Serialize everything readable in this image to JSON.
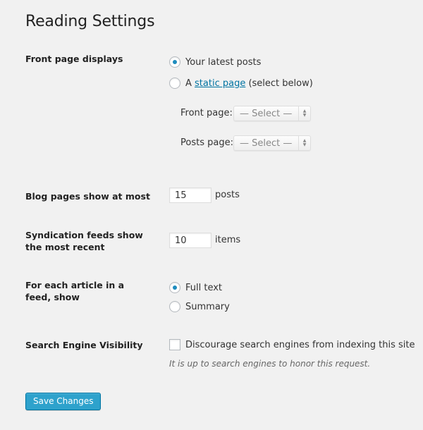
{
  "page": {
    "title": "Reading Settings"
  },
  "front_page_displays": {
    "label": "Front page displays",
    "options": [
      {
        "label": "Your latest posts",
        "checked": true
      },
      {
        "prefix": "A ",
        "link_text": "static page",
        "suffix": " (select below)",
        "checked": false
      }
    ],
    "front_page": {
      "label": "Front page:",
      "selected": "— Select —"
    },
    "posts_page": {
      "label": "Posts page:",
      "selected": "— Select —"
    }
  },
  "blog_pages": {
    "label": "Blog pages show at most",
    "value": "15",
    "unit": "posts"
  },
  "syndication": {
    "label": "Syndication feeds show the most recent",
    "value": "10",
    "unit": "items"
  },
  "feed_article": {
    "label": "For each article in a feed, show",
    "options": [
      {
        "label": "Full text",
        "checked": true
      },
      {
        "label": "Summary",
        "checked": false
      }
    ]
  },
  "search_visibility": {
    "label": "Search Engine Visibility",
    "checkbox_label": "Discourage search engines from indexing this site",
    "checked": false,
    "description": "It is up to search engines to honor this request."
  },
  "actions": {
    "save_label": "Save Changes"
  },
  "colors": {
    "accent": "#2ea2cc",
    "link": "#0074a2",
    "radio_dot": "#1e8cbe",
    "background": "#f1f1f1"
  },
  "icons": {
    "select_arrows": "▲▼"
  }
}
